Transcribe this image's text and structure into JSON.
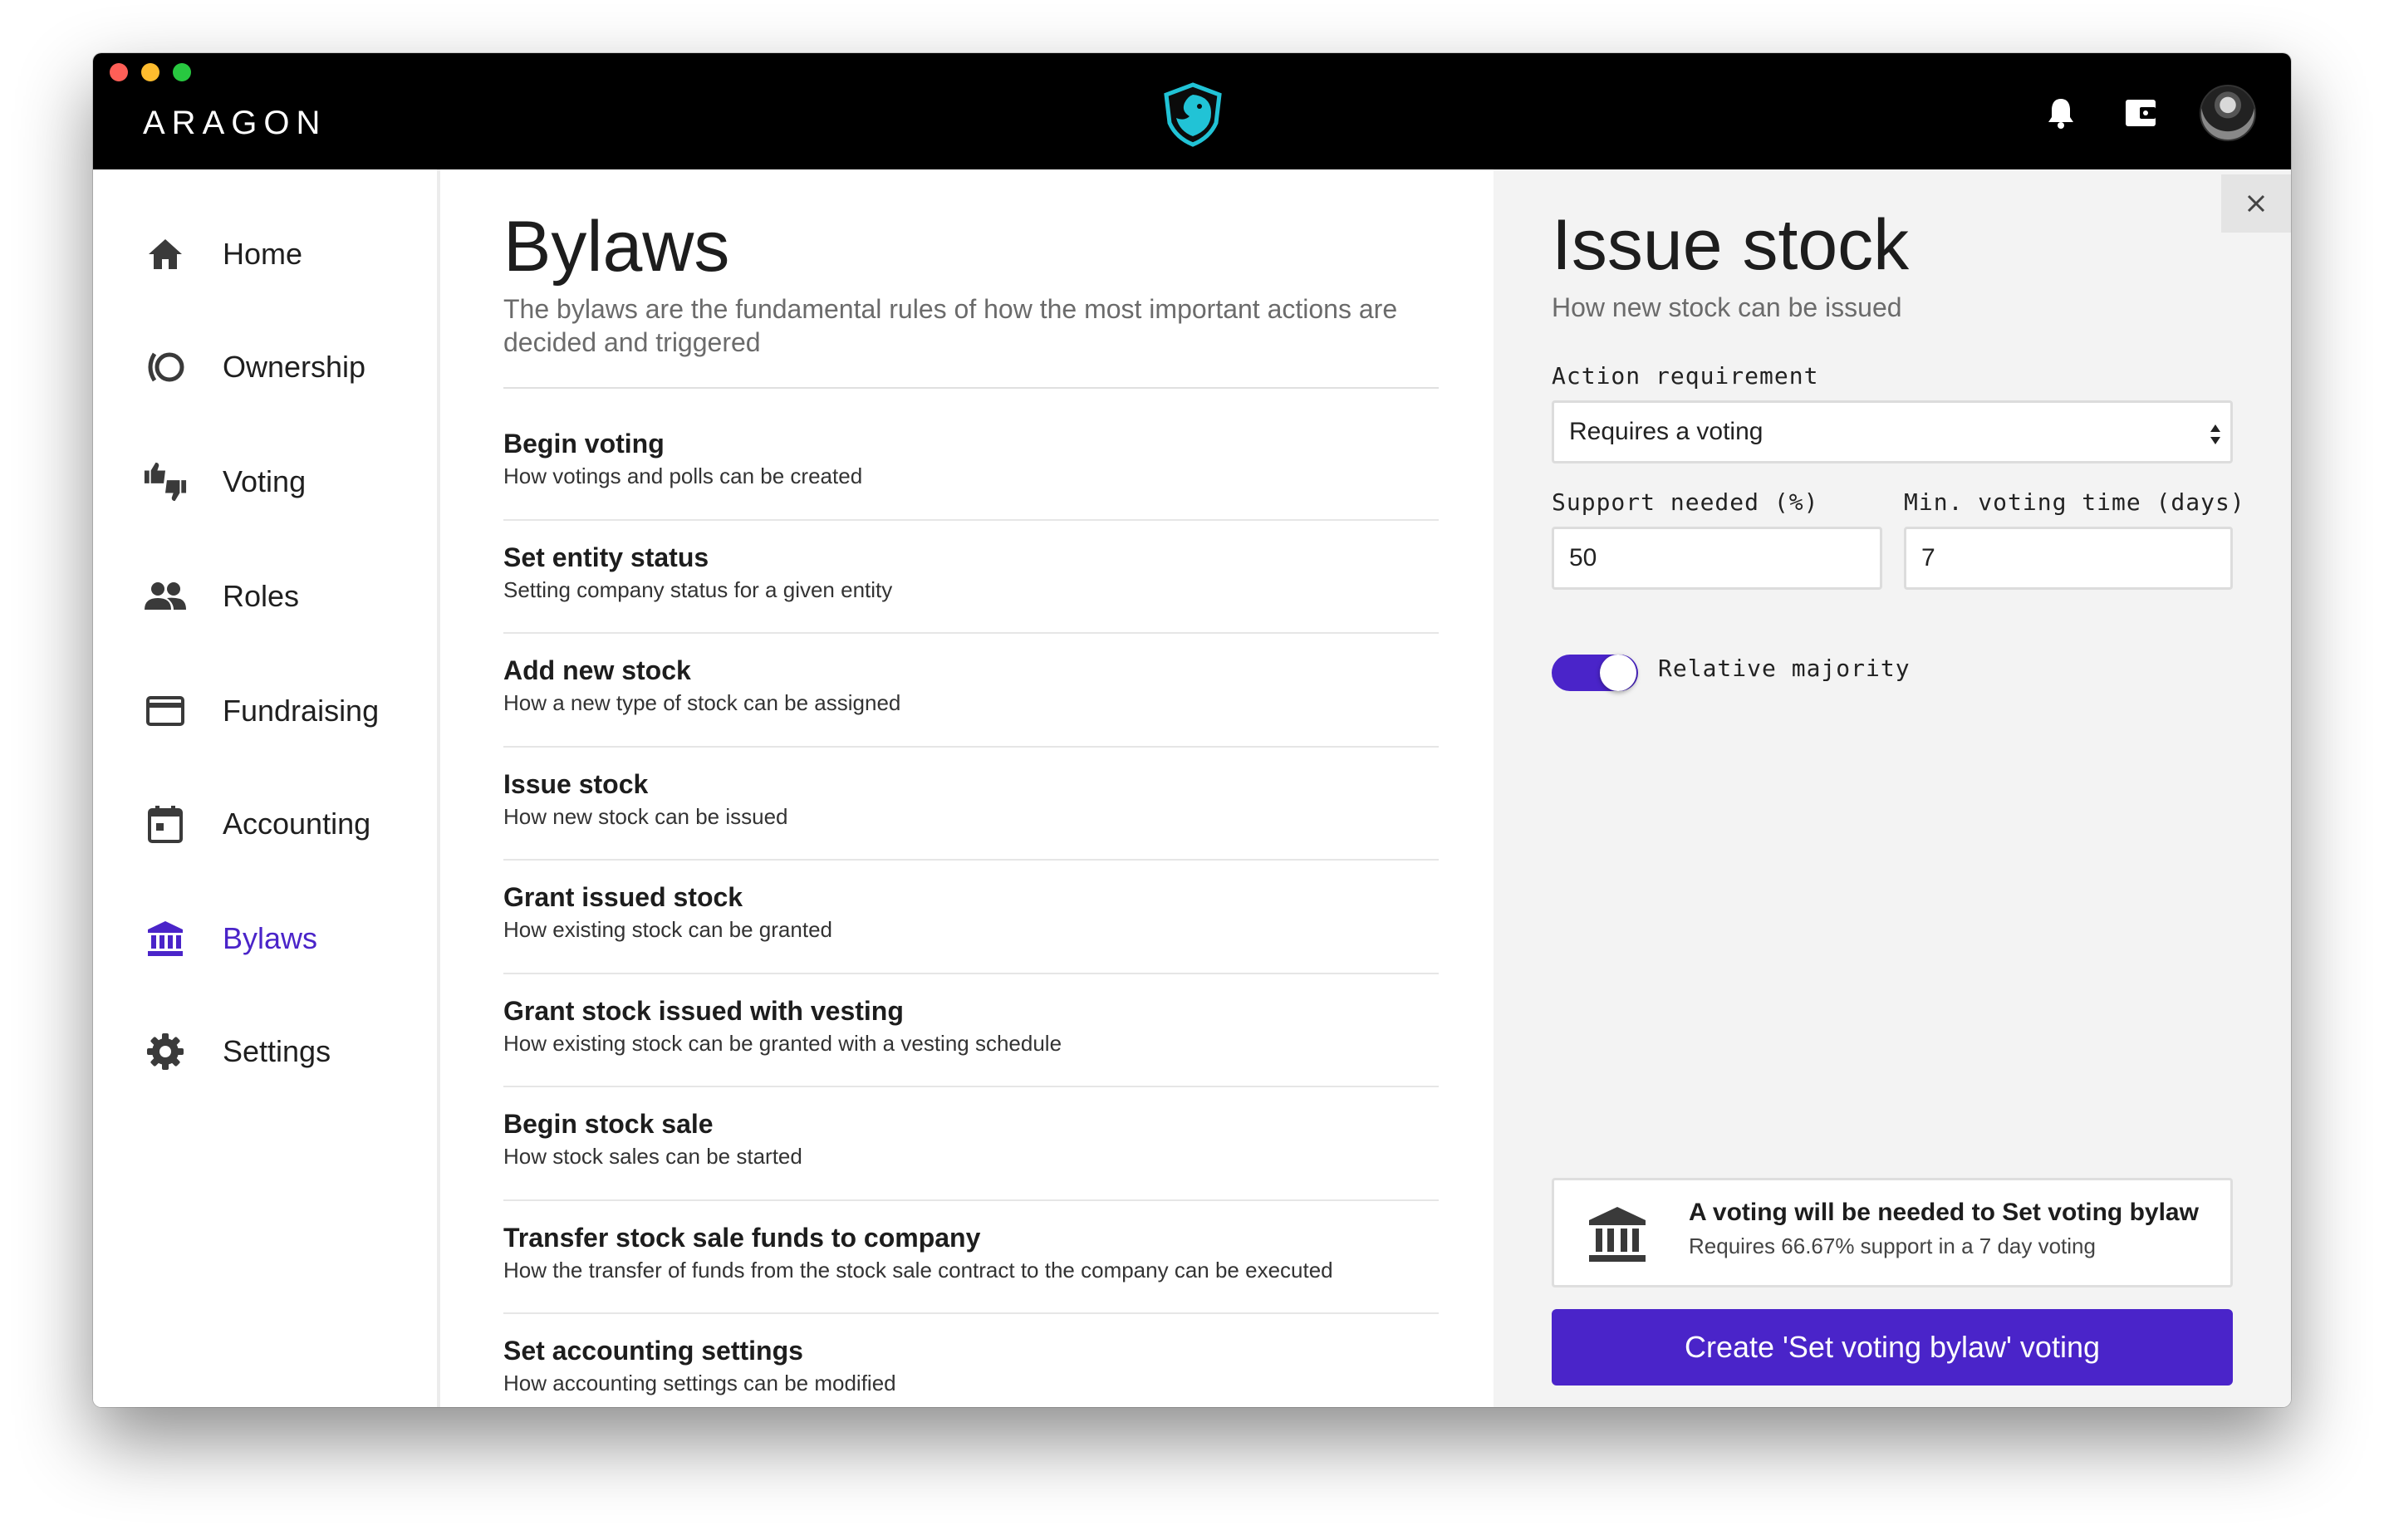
{
  "window": {
    "brand": "ARAGON",
    "icons": [
      "bell-icon",
      "wallet-icon",
      "avatar"
    ]
  },
  "sidebar": {
    "items": [
      {
        "label": "Home",
        "icon": "home-icon"
      },
      {
        "label": "Ownership",
        "icon": "ownership-icon"
      },
      {
        "label": "Voting",
        "icon": "thumbs-vote-icon"
      },
      {
        "label": "Roles",
        "icon": "people-icon"
      },
      {
        "label": "Fundraising",
        "icon": "credit-card-icon"
      },
      {
        "label": "Accounting",
        "icon": "calendar-icon"
      },
      {
        "label": "Bylaws",
        "icon": "bank-icon",
        "active": true
      },
      {
        "label": "Settings",
        "icon": "gear-icon"
      }
    ]
  },
  "main": {
    "title": "Bylaws",
    "subtitle": "The bylaws are the fundamental rules of how the most important actions are decided and triggered",
    "bylaws": [
      {
        "title": "Begin voting",
        "desc": "How votings and polls can be created"
      },
      {
        "title": "Set entity status",
        "desc": "Setting company status for a given entity"
      },
      {
        "title": "Add new stock",
        "desc": "How a new type of stock can be assigned"
      },
      {
        "title": "Issue stock",
        "desc": "How new stock can be issued"
      },
      {
        "title": "Grant issued stock",
        "desc": "How existing stock can be granted"
      },
      {
        "title": "Grant stock issued with vesting",
        "desc": "How existing stock can be granted with a vesting schedule"
      },
      {
        "title": "Begin stock sale",
        "desc": "How stock sales can be started"
      },
      {
        "title": "Transfer stock sale funds to company",
        "desc": "How the transfer of funds from the stock sale contract to the company can be executed"
      },
      {
        "title": "Set accounting settings",
        "desc": "How accounting settings can be modified"
      }
    ]
  },
  "panel": {
    "title": "Issue stock",
    "subtitle": "How new stock can be issued",
    "action_label": "Action requirement",
    "action_value": "Requires a voting",
    "support_label": "Support needed (%)",
    "support_value": "50",
    "time_label": "Min. voting time (days)",
    "time_value": "7",
    "toggle_label": "Relative majority",
    "toggle_on": true,
    "info_title": "A voting will be needed to Set voting bylaw",
    "info_desc": "Requires 66.67% support in a 7 day voting",
    "cta_label": "Create 'Set voting bylaw' voting",
    "accent": "#4a24c9"
  }
}
